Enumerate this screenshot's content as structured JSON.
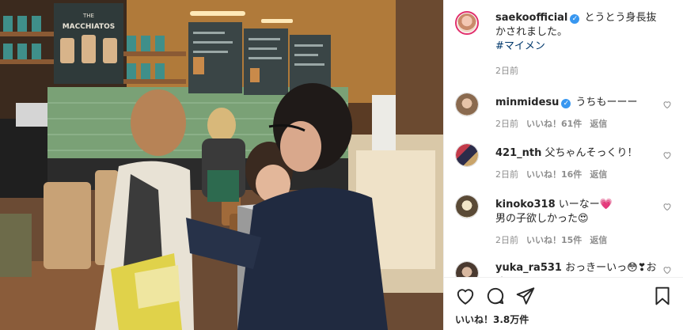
{
  "post": {
    "username": "saekoofficial",
    "verified_mark": "✓",
    "caption": "とうとう身長抜かされました。",
    "hashtag": "#マイメン",
    "time": "2日前"
  },
  "photo": {
    "menu_board_title_small": "THE",
    "menu_board_title": "MACCHIATOS"
  },
  "comments": [
    {
      "username": "minmidesu",
      "verified": true,
      "text": "うちもーーー",
      "time": "2日前",
      "likes": "いいね！61件",
      "reply": "返信"
    },
    {
      "username": "421_nth",
      "verified": false,
      "text": "父ちゃんそっくり！",
      "time": "2日前",
      "likes": "いいね！16件",
      "reply": "返信"
    },
    {
      "username": "kinoko318",
      "verified": false,
      "text": "いーなー💗",
      "text2": "男の子欲しかった😍",
      "time": "2日前",
      "likes": "いいね！15件",
      "reply": "返信"
    },
    {
      "username": "yuka_ra531",
      "verified": false,
      "text": "おっきーいっ😳❣おめ"
    }
  ],
  "actions": {
    "icons": [
      "heart-icon",
      "comment-icon",
      "share-icon",
      "bookmark-icon"
    ],
    "likes_count": "いいね！3.8万件"
  },
  "colors": {
    "verified": "#3897f0",
    "hashtag": "#00376b",
    "muted": "#8e8e8e",
    "story_ring": "#e1306c"
  }
}
